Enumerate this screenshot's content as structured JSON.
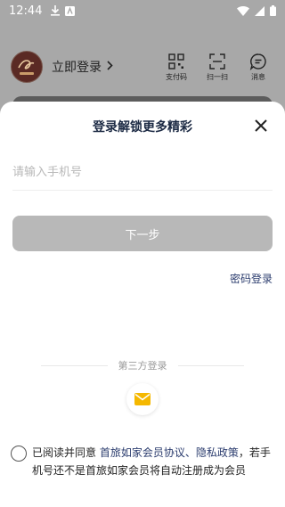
{
  "status_bar": {
    "time": "12:44",
    "icons": [
      "download-icon",
      "notification-app-icon",
      "wifi-icon",
      "signal-icon",
      "battery-icon"
    ]
  },
  "header": {
    "avatar_text": "",
    "login_label": "立即登录",
    "actions": [
      {
        "label": "支付码",
        "icon": "qr-code-icon"
      },
      {
        "label": "扫一扫",
        "icon": "scan-icon"
      },
      {
        "label": "消息",
        "icon": "message-icon"
      }
    ]
  },
  "sheet": {
    "title": "登录解锁更多精彩",
    "phone_placeholder": "请输入手机号",
    "next_label": "下一步",
    "password_login": "密码登录",
    "third_party_label": "第三方登录",
    "agreement": {
      "prefix": "已阅读并同意 ",
      "link1": "首旅如家会员协议",
      "sep": "、",
      "link2": "隐私政策",
      "suffix": "，若手机号还不是首旅如家会员将自动注册成为会员"
    }
  },
  "colors": {
    "accent": "#2b3c6e",
    "button_disabled": "#b8b8b8",
    "mail_icon": "#f5b800"
  }
}
